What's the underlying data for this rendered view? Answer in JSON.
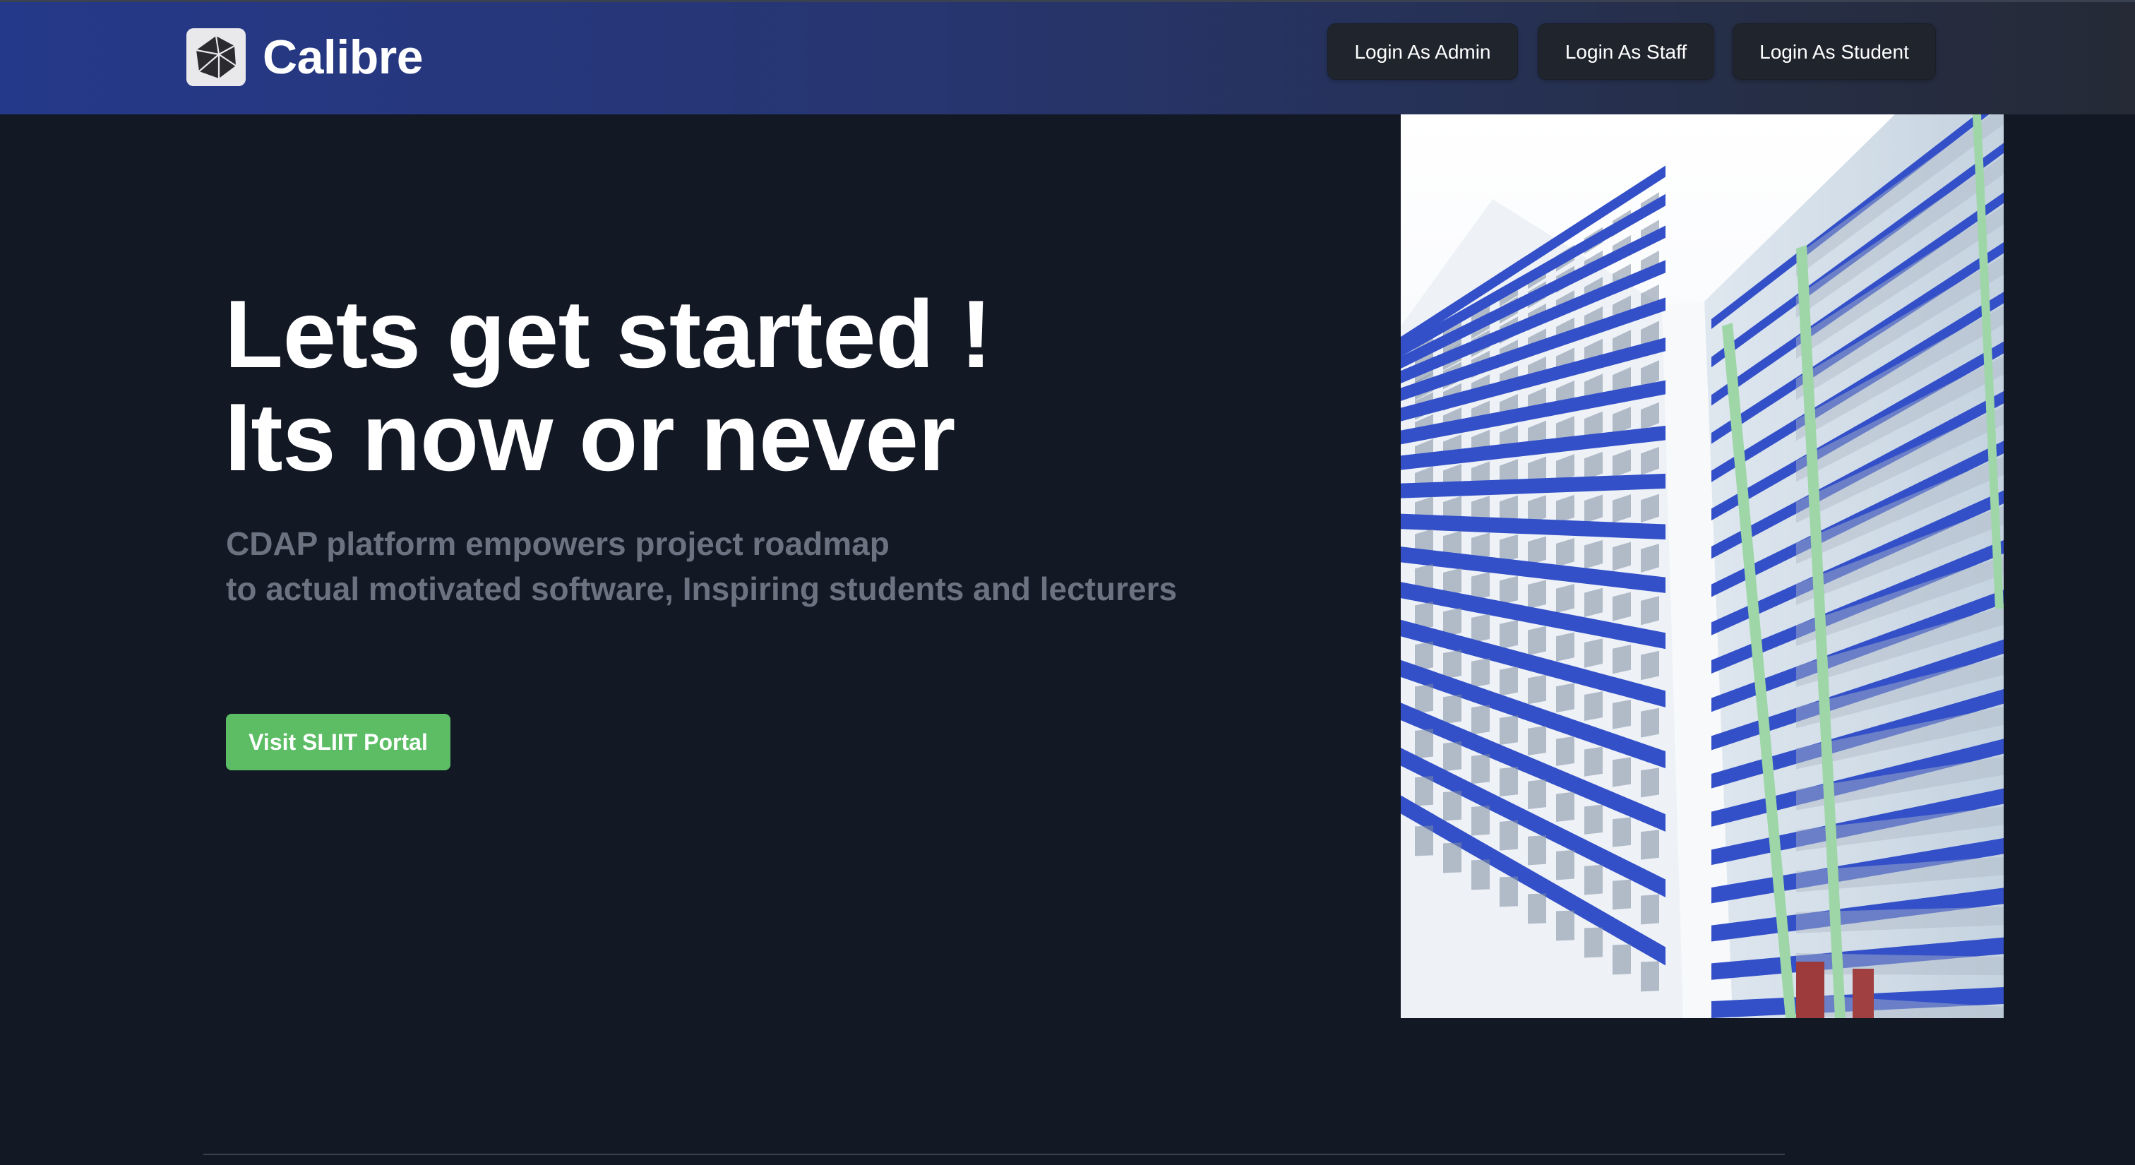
{
  "brand": {
    "name": "Calibre",
    "logo_icon": "cube-logo-icon"
  },
  "nav": {
    "buttons": [
      {
        "label": "Login As Admin"
      },
      {
        "label": "Login As Staff"
      },
      {
        "label": "Login As Student"
      }
    ]
  },
  "hero": {
    "headline": [
      "Lets get started !",
      "Its now or never"
    ],
    "subtext": [
      "CDAP platform empowers project roadmap",
      "to actual motivated software, Inspiring students and lecturers"
    ],
    "cta_label": "Visit SLIIT Portal"
  },
  "colors": {
    "navbar_start": "#25398a",
    "navbar_end": "#252a36",
    "page_background": "#131825",
    "cta": "#5cbd65",
    "subtext": "#6b7280",
    "building_accent": "#3350c8"
  }
}
